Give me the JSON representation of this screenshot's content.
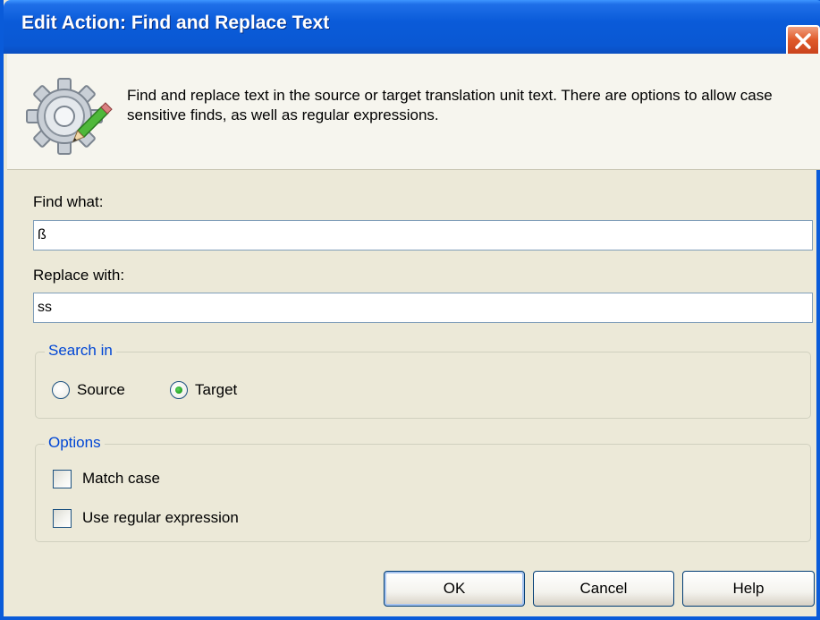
{
  "window": {
    "title": "Edit Action: Find and Replace Text"
  },
  "header": {
    "description": "Find and replace text in the source or target translation unit text. There are options to allow case sensitive finds, as well as regular expressions."
  },
  "find": {
    "label": "Find what:",
    "value": "ß"
  },
  "replace": {
    "label": "Replace with:",
    "value": "ss"
  },
  "search_in": {
    "title": "Search in",
    "options": [
      {
        "label": "Source",
        "selected": false
      },
      {
        "label": "Target",
        "selected": true
      }
    ]
  },
  "options": {
    "title": "Options",
    "items": [
      {
        "label": "Match case",
        "checked": false
      },
      {
        "label": "Use regular expression",
        "checked": false
      }
    ]
  },
  "buttons": {
    "ok": "OK",
    "cancel": "Cancel",
    "help": "Help"
  },
  "colors": {
    "titlebar": "#0a5bd9",
    "group_title": "#0046d5",
    "dialog_bg": "#ece9d8",
    "radio_selected": "#21a121"
  },
  "icons": {
    "header": "gear-pencil-icon",
    "close": "close-icon"
  }
}
